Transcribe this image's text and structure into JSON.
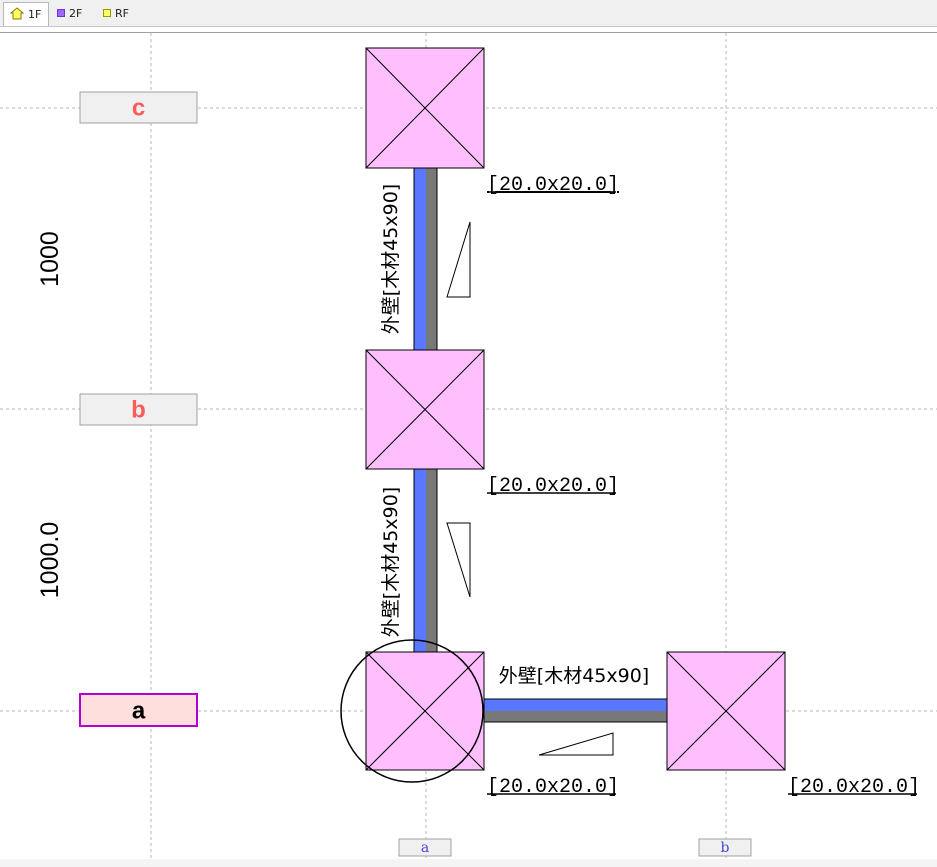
{
  "tabs": [
    {
      "label": "1F",
      "active": true,
      "icon": "house-icon",
      "icon_color": "#ffff66"
    },
    {
      "label": "2F",
      "active": false,
      "icon": "square-icon",
      "icon_color": "#a066ff"
    },
    {
      "label": "RF",
      "active": false,
      "icon": "square-icon",
      "icon_color": "#ffff66"
    }
  ],
  "row_labels": [
    {
      "label": "c",
      "selected": false
    },
    {
      "label": "b",
      "selected": false
    },
    {
      "label": "a",
      "selected": true
    }
  ],
  "col_labels": [
    "a",
    "b"
  ],
  "dimensions": [
    "1000",
    "1000.0"
  ],
  "columns": [
    {
      "size": "[20.0x20.0]"
    },
    {
      "size": "[20.0x20.0]"
    },
    {
      "size": "[20.0x20.0]"
    },
    {
      "size": "[20.0x20.0]"
    }
  ],
  "walls": [
    {
      "label": "外壁[木材45x90]"
    },
    {
      "label": "外壁[木材45x90]"
    },
    {
      "label": "外壁[木材45x90]"
    }
  ],
  "colors": {
    "column_fill": "#ffbfff",
    "wall_blue": "#5a78ff",
    "wall_gray": "#787878",
    "row_label_text": "#ff5a5a",
    "row_label_selected_bg": "#ffdede",
    "row_label_selected_border": "#b400d2",
    "col_label_text": "#4646d2"
  }
}
